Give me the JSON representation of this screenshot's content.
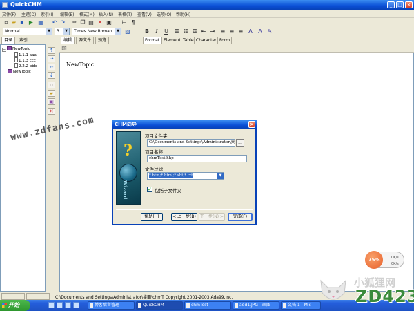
{
  "window": {
    "title": "QuickCHM",
    "min": "_",
    "max": "□",
    "close": "×"
  },
  "menu": [
    "文件(F)",
    "主题(D)",
    "索引(I)",
    "编辑(E)",
    "格式(M)",
    "插入(N)",
    "表格(T)",
    "查看(V)",
    "选项(O)",
    "帮助(H)"
  ],
  "format_bar": {
    "style": "Normal",
    "size": "3",
    "font": "Times New Roman",
    "tabs": [
      "Format",
      "Element",
      "Table",
      "Characters",
      "Form"
    ],
    "active_tab": "Format",
    "bold": "B",
    "italic": "I",
    "underline": "U"
  },
  "left_panel": {
    "tabs": [
      "目录",
      "索引"
    ],
    "tree": [
      {
        "label": "NewTopic",
        "level": 0,
        "type": "book"
      },
      {
        "label": "1.1.1 aaa",
        "level": 1,
        "type": "page"
      },
      {
        "label": "1.1.3 ccc",
        "level": 1,
        "type": "page"
      },
      {
        "label": "2.2.2 bbb",
        "level": 1,
        "type": "page"
      },
      {
        "label": "NewTopic",
        "level": 0,
        "type": "book"
      }
    ]
  },
  "editor": {
    "tabs": [
      "编辑",
      "源文件",
      "预览"
    ],
    "content": "NewTopic"
  },
  "status_bar": {
    "path": "C:\\Documents and Settings\\Administrator\\桌面\\chmT Copyright 2001-2003  Ada99,Inc."
  },
  "dialog": {
    "title": "CHM向导",
    "art_text": "Wizard",
    "project_folder_label": "项目文件夹",
    "project_folder_value": "C:\\Documents and Settings\\Administrator\\桌",
    "browse_label": "...",
    "project_name_label": "项目名称",
    "project_name_value": "chmTest.hhp",
    "filter_label": "文件过滤",
    "filter_value": "*.htm;*.html;*.sht;*.txt",
    "include_subfolders_label": "包括子文件夹",
    "include_subfolders_checked": true,
    "buttons": {
      "help": "帮助(H)",
      "back": "< 上一步(B)",
      "next": "下一步(N) >",
      "finish": "完成(F)"
    }
  },
  "taskbar": {
    "start": "开始",
    "tasks": [
      "博客后台管理",
      "QuickCHM",
      "chmTest",
      "add1.JPG - 画图",
      "文档 1 - Mic"
    ]
  },
  "overlays": {
    "watermark": "www.zdfans.com",
    "cpu_percent": "75%",
    "cpu_up": "0K/s",
    "cpu_down": "0K/s",
    "brand_cn": "小狐狸网",
    "brand_num": "ZD423"
  }
}
